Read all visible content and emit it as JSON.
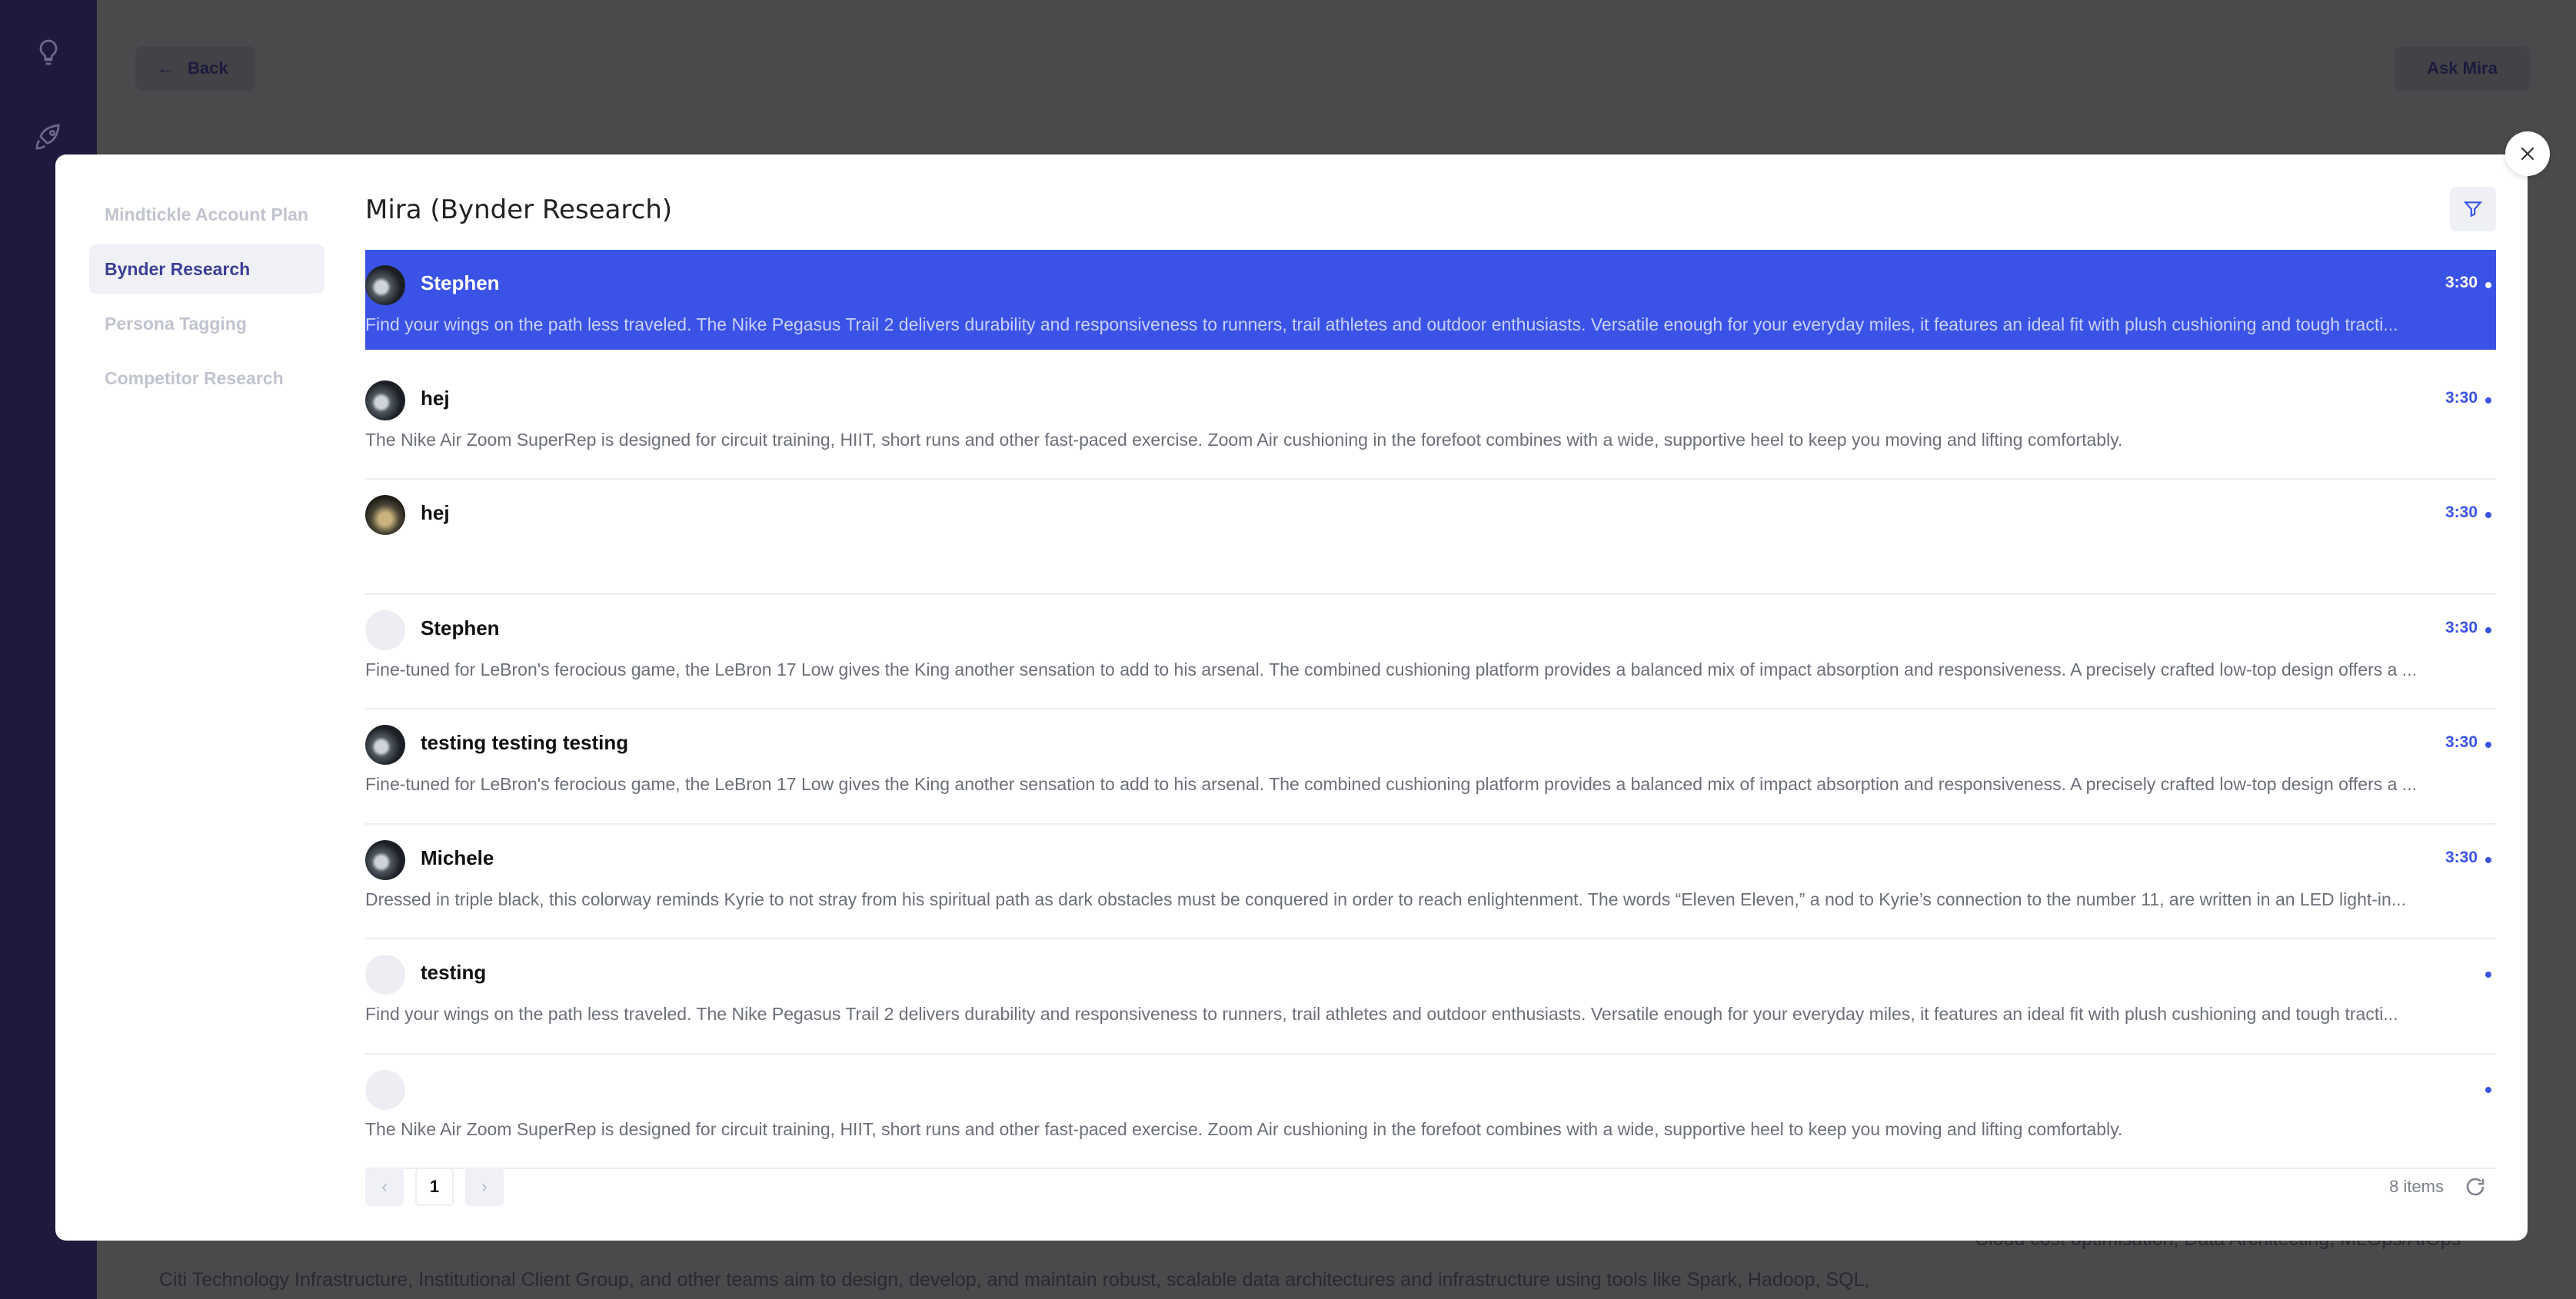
{
  "background": {
    "back_label": "Back",
    "ask_label": "Ask Mira",
    "text_line": "Citi Technology Infrastructure, Institutional Client Group, and other teams aim to design, develop, and maintain robust, scalable data architectures and infrastructure using tools like Spark, Hadoop, SQL,",
    "text_right": "Cloud cost optimisation, Data Architecting, MLOps/AIOps"
  },
  "sidebar": {
    "items": [
      {
        "label": "Mindtickle Account Plan"
      },
      {
        "label": "Bynder Research"
      },
      {
        "label": "Persona Tagging"
      },
      {
        "label": "Competitor Research"
      }
    ]
  },
  "header": {
    "title": "Mira (Bynder Research)"
  },
  "rows": [
    {
      "name": "Stephen",
      "time": "3:30",
      "desc": "Find your wings on the path less traveled. The Nike Pegasus Trail 2 delivers durability and responsiveness to runners, trail athletes and outdoor enthusiasts. Versatile enough for your everyday miles, it features an ideal fit with plush cushioning and tough tracti..."
    },
    {
      "name": "hej",
      "time": "3:30",
      "desc": "The Nike Air Zoom SuperRep is designed for circuit training, HIIT, short runs and other fast-paced exercise. Zoom Air cushioning in the forefoot combines with a wide, supportive heel to keep you moving and lifting comfortably."
    },
    {
      "name": "hej",
      "time": "3:30",
      "desc": ""
    },
    {
      "name": "Stephen",
      "time": "3:30",
      "desc": "Fine-tuned for LeBron's ferocious game, the LeBron 17 Low gives the King another sensation to add to his arsenal. The combined cushioning platform provides a balanced mix of impact absorption and responsiveness. A precisely crafted low-top design offers a ..."
    },
    {
      "name": "testing testing testing",
      "time": "3:30",
      "desc": "Fine-tuned for LeBron's ferocious game, the LeBron 17 Low gives the King another sensation to add to his arsenal. The combined cushioning platform provides a balanced mix of impact absorption and responsiveness. A precisely crafted low-top design offers a ..."
    },
    {
      "name": "Michele",
      "time": "3:30",
      "desc": "Dressed in triple black, this colorway reminds Kyrie to not stray from his spiritual path as dark obstacles must be conquered in order to reach enlightenment. The words “Eleven Eleven,” a nod to Kyrie’s connection to the number 11, are written in an LED light-in..."
    },
    {
      "name": "testing",
      "time": "",
      "desc": "Find your wings on the path less traveled. The Nike Pegasus Trail 2 delivers durability and responsiveness to runners, trail athletes and outdoor enthusiasts. Versatile enough for your everyday miles, it features an ideal fit with plush cushioning and tough tracti..."
    },
    {
      "name": "",
      "time": "",
      "desc": "The Nike Air Zoom SuperRep is designed for circuit training, HIIT, short runs and other fast-paced exercise. Zoom Air cushioning in the forefoot combines with a wide, supportive heel to keep you moving and lifting comfortably."
    }
  ],
  "pagination": {
    "prev": "‹",
    "current": "1",
    "next": "›",
    "count": "8 items"
  },
  "colors": {
    "accent": "#3a53e6",
    "nav": "#1f1a3d",
    "active_sidebar_text": "#3a3f96"
  }
}
